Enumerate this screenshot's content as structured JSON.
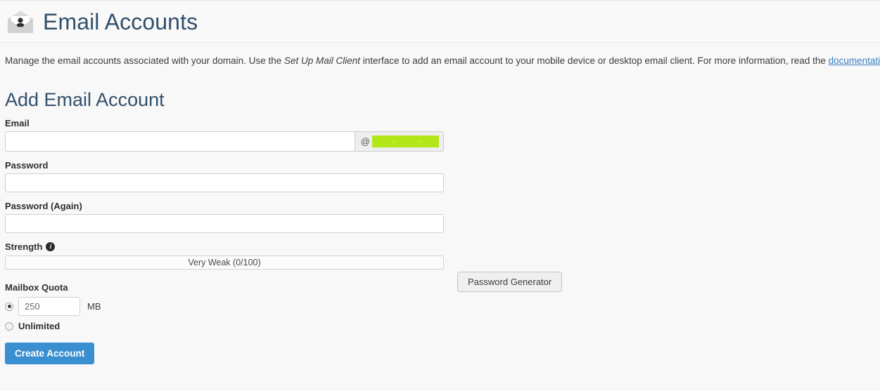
{
  "header": {
    "icon": "email-account-envelope-icon",
    "title": "Email Accounts"
  },
  "intro": {
    "text_before_em": "Manage the email accounts associated with your domain. Use the ",
    "emphasis": "Set Up Mail Client",
    "text_after_em": " interface to add an email account to your mobile device or desktop email client. For more information, read the ",
    "link_text": "documentation",
    "text_end": "."
  },
  "form": {
    "heading": "Add Email Account",
    "email": {
      "label": "Email",
      "value": "",
      "placeholder": "",
      "at_sign": "@",
      "domain": ""
    },
    "password": {
      "label": "Password",
      "value": "",
      "placeholder": ""
    },
    "password_again": {
      "label": "Password (Again)",
      "value": "",
      "placeholder": ""
    },
    "strength": {
      "label": "Strength",
      "info_glyph": "i",
      "bar_text": "Very Weak (0/100)",
      "score": 0,
      "max_score": 100,
      "generator_button": "Password Generator"
    },
    "quota": {
      "label": "Mailbox Quota",
      "sized_selected": true,
      "size_value": "250",
      "unit": "MB",
      "unlimited_label": "Unlimited",
      "unlimited_selected": false
    },
    "submit_label": "Create Account"
  },
  "colors": {
    "title": "#32506b",
    "link": "#3a7fc1",
    "primary_button": "#3a8fd0",
    "redaction": "#b2e619",
    "page_background": "#f8f8f8"
  }
}
